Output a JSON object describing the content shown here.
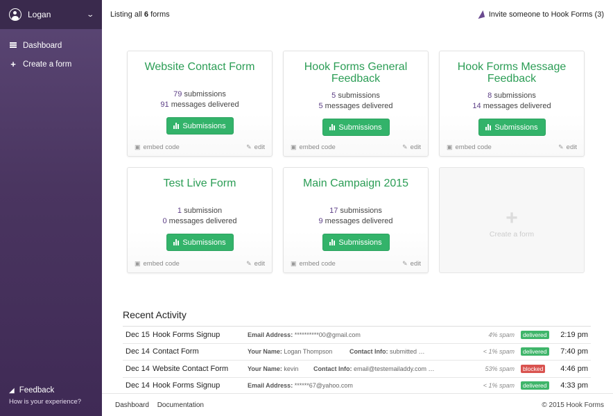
{
  "sidebar": {
    "user_name": "Logan",
    "items": [
      {
        "label": "Dashboard",
        "icon": "list-icon"
      },
      {
        "label": "Create a form",
        "icon": "plus-icon"
      }
    ],
    "feedback_label": "Feedback",
    "feedback_sub": "How is your experience?"
  },
  "header": {
    "listing_prefix": "Listing all ",
    "listing_count": "6",
    "listing_suffix": " forms",
    "invite_label": "Invite someone to Hook Forms (3)"
  },
  "forms": [
    {
      "title": "Website Contact Form",
      "submissions": "79",
      "submissions_label": " submissions",
      "messages": "91",
      "messages_label": " messages delivered"
    },
    {
      "title": "Hook Forms General Feedback",
      "submissions": "5",
      "submissions_label": " submissions",
      "messages": "5",
      "messages_label": " messages delivered"
    },
    {
      "title": "Hook Forms Message Feedback",
      "submissions": "8",
      "submissions_label": " submissions",
      "messages": "14",
      "messages_label": " messages delivered"
    },
    {
      "title": "Test Live Form",
      "submissions": "1",
      "submissions_label": " submission",
      "messages": "0",
      "messages_label": " messages delivered"
    },
    {
      "title": "Main Campaign 2015",
      "submissions": "17",
      "submissions_label": " submissions",
      "messages": "9",
      "messages_label": " messages delivered"
    }
  ],
  "card_actions": {
    "submissions_button": "Submissions",
    "embed": "embed code",
    "edit": "edit"
  },
  "create_card_label": "Create a form",
  "activity": {
    "title": "Recent Activity",
    "rows": [
      {
        "date": "Dec 15",
        "form": "Hook Forms Signup",
        "field1_label": "Email Address:",
        "field1_value": " **********00@gmail.com",
        "field2_label": "",
        "field2_value": "",
        "spam": "4% spam",
        "status": "delivered",
        "time": "2:19 pm"
      },
      {
        "date": "Dec 14",
        "form": "Contact Form",
        "field1_label": "Your Name:",
        "field1_value": " Logan Thompson",
        "field2_label": "Contact Info:",
        "field2_value": " submitted …",
        "spam": "< 1% spam",
        "status": "delivered",
        "time": "7:40 pm"
      },
      {
        "date": "Dec 14",
        "form": "Website Contact Form",
        "field1_label": "Your Name:",
        "field1_value": " kevin",
        "field2_label": "Contact Info:",
        "field2_value": " email@testemailaddy.com …",
        "spam": "53% spam",
        "status": "blocked",
        "time": "4:46 pm"
      },
      {
        "date": "Dec 14",
        "form": "Hook Forms Signup",
        "field1_label": "Email Address:",
        "field1_value": " ******67@yahoo.com",
        "field2_label": "",
        "field2_value": "",
        "spam": "< 1% spam",
        "status": "delivered",
        "time": "4:33 pm"
      }
    ]
  },
  "footer": {
    "links": [
      "Dashboard",
      "Documentation"
    ],
    "copyright": "© 2015 Hook Forms"
  },
  "colors": {
    "accent_green": "#33b36a",
    "title_green": "#2b9d55",
    "sidebar_purple": "#4a3560"
  }
}
